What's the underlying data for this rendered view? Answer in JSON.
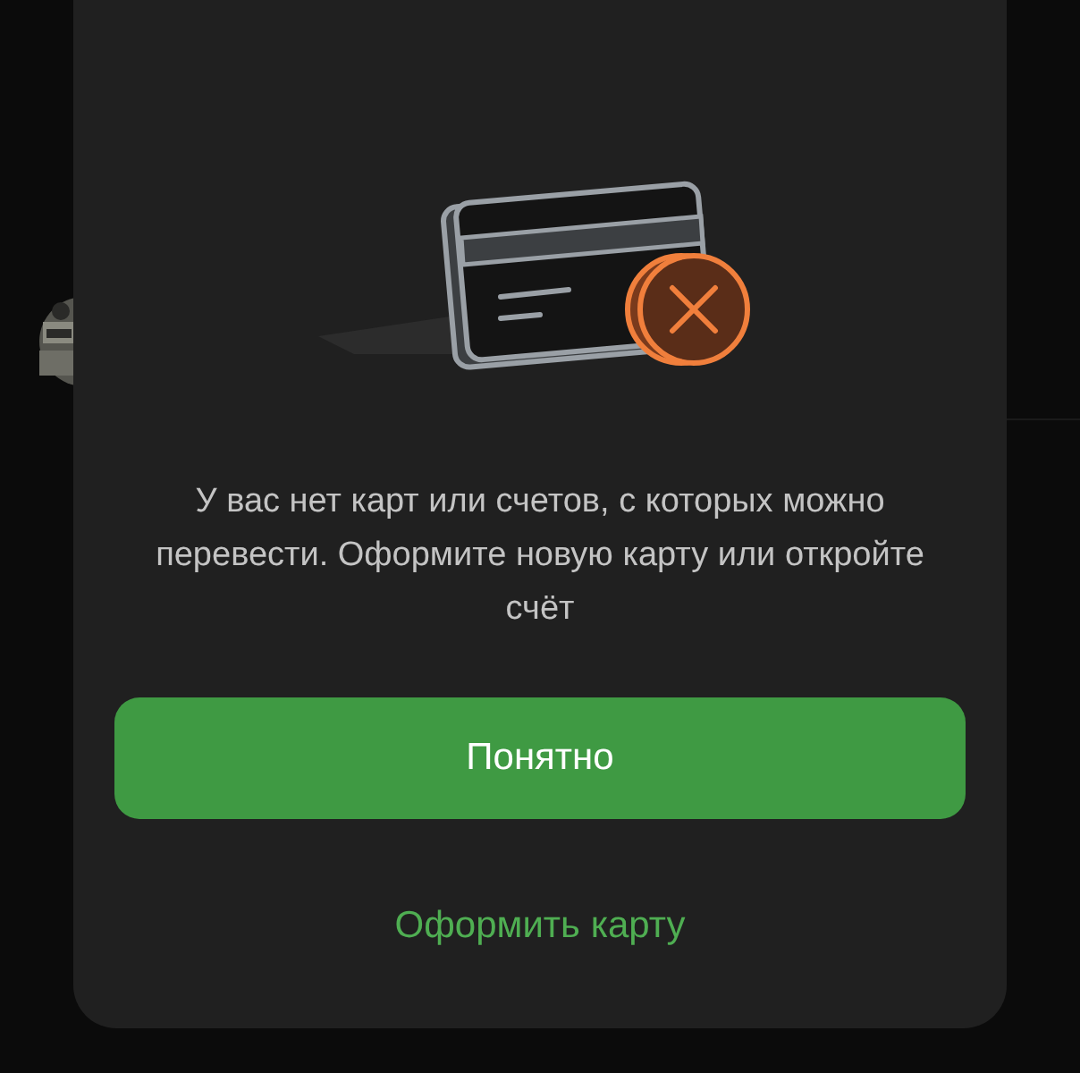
{
  "dialog": {
    "message": "У вас нет карт или счетов, с которых можно перевести. Оформите новую карту или откройте счёт",
    "primary_button": "Понятно",
    "secondary_link": "Оформить карту"
  }
}
